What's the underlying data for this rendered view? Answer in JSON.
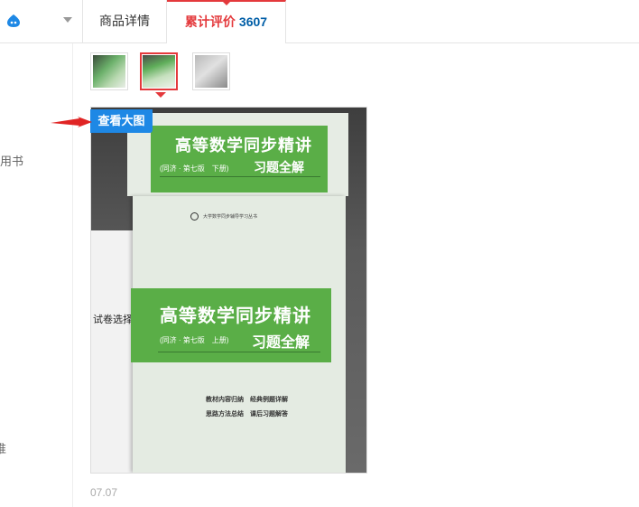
{
  "tabs": {
    "details_label": "商品详情",
    "reviews_label": "累计评价",
    "reviews_count": "3607"
  },
  "left_fragments": [
    "用书",
    "试卷选",
    "推"
  ],
  "thumbnails": [
    "thumb-1",
    "thumb-2",
    "thumb-3"
  ],
  "selected_thumbnail_index": 1,
  "view_large_label": "查看大图",
  "book": {
    "title": "高等数学同步精讲",
    "top_subtitle": "(同济 · 第七版　下册)",
    "bottom_subtitle": "(同济 · 第七版　上册)",
    "solutions": "习题全解",
    "features_line1": "教材内容归纳　经典例题详解",
    "features_line2": "思路方法总结　课后习题解答"
  },
  "photo_paper_text": "试卷选择",
  "review_date": "07.07",
  "colors": {
    "accent_red": "#e4393c",
    "count_blue": "#005ea7",
    "button_blue": "#1e88e5",
    "book_green": "#5aae47"
  }
}
